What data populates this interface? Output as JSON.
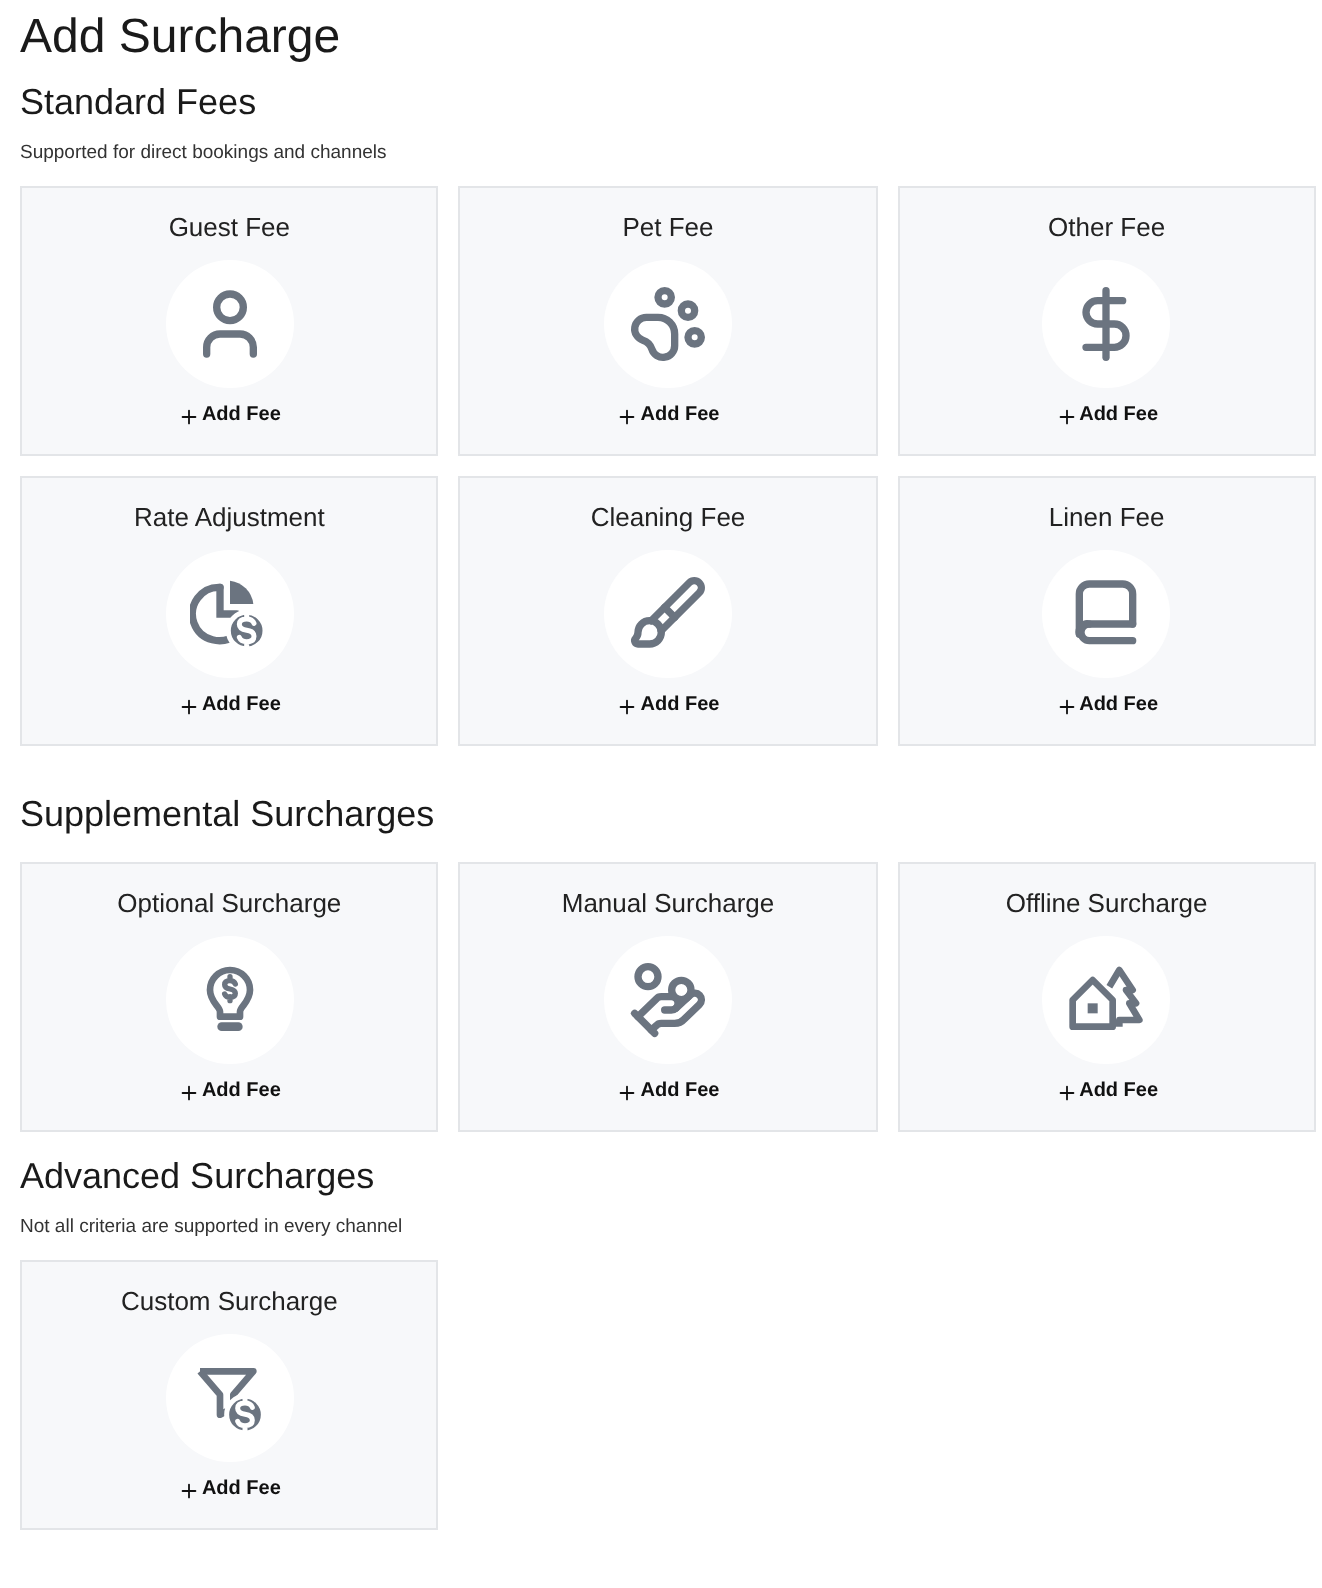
{
  "title": "Add Surcharge",
  "sections": [
    {
      "heading": "Standard Fees",
      "description": "Supported for direct bookings and channels",
      "cards": [
        {
          "title": "Guest Fee",
          "action": "Add Fee"
        },
        {
          "title": "Pet Fee",
          "action": "Add Fee"
        },
        {
          "title": "Other Fee",
          "action": "Add Fee"
        },
        {
          "title": "Rate Adjustment",
          "action": "Add Fee"
        },
        {
          "title": "Cleaning Fee",
          "action": "Add Fee"
        },
        {
          "title": "Linen Fee",
          "action": "Add Fee"
        }
      ]
    },
    {
      "heading": "Supplemental Surcharges",
      "cards": [
        {
          "title": "Optional Surcharge",
          "action": "Add Fee"
        },
        {
          "title": "Manual Surcharge",
          "action": "Add Fee"
        },
        {
          "title": "Offline Surcharge",
          "action": "Add Fee"
        }
      ]
    },
    {
      "heading": "Advanced Surcharges",
      "description": "Not all criteria are supported in every channel",
      "cards": [
        {
          "title": "Custom Surcharge",
          "action": "Add Fee"
        }
      ]
    }
  ]
}
